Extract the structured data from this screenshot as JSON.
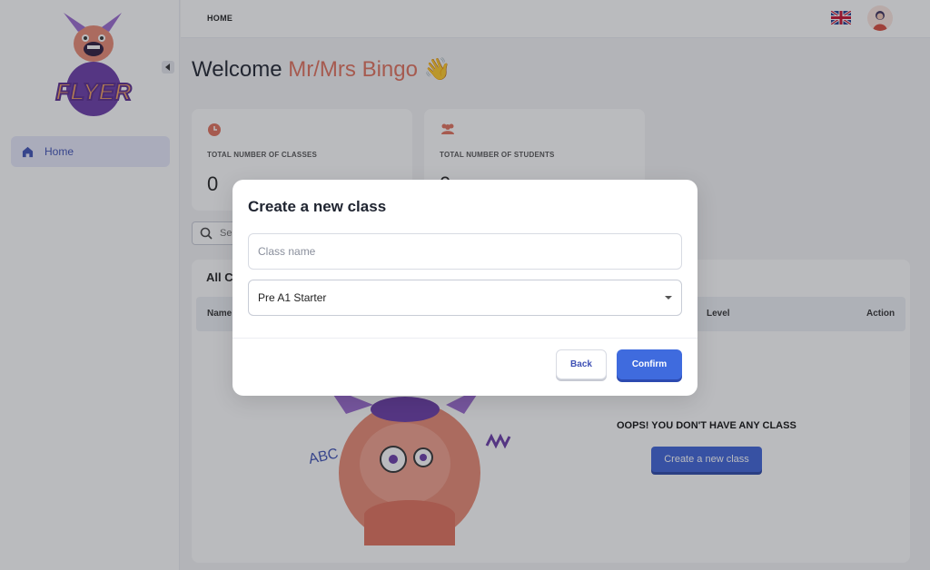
{
  "sidebar": {
    "logo_text": "FLYER",
    "nav": [
      {
        "label": "Home",
        "icon": "home-icon",
        "active": true
      }
    ]
  },
  "header": {
    "breadcrumb": "HOME",
    "language_icon": "uk-flag-icon"
  },
  "welcome": {
    "prefix": "Welcome ",
    "name": "Mr/Mrs Bingo",
    "emoji": "👋"
  },
  "stats": [
    {
      "label": "TOTAL NUMBER OF CLASSES",
      "value": "0",
      "icon": "clock-icon"
    },
    {
      "label": "TOTAL NUMBER OF STUDENTS",
      "value": "0",
      "icon": "users-icon"
    }
  ],
  "search": {
    "placeholder": "Se"
  },
  "classes_table": {
    "title": "All C",
    "columns": [
      "Name",
      "Level",
      "Action"
    ],
    "empty_message": "OOPS! YOU DON'T HAVE ANY CLASS",
    "create_button": "Create a new class",
    "illustration_text": "ABC"
  },
  "modal": {
    "title": "Create a new class",
    "class_name_placeholder": "Class name",
    "level_value": "Pre A1 Starter",
    "back_label": "Back",
    "confirm_label": "Confirm"
  },
  "colors": {
    "accent": "#3f63d8",
    "highlight_name": "#e2715c",
    "active_nav_bg": "#e7e9fb"
  }
}
